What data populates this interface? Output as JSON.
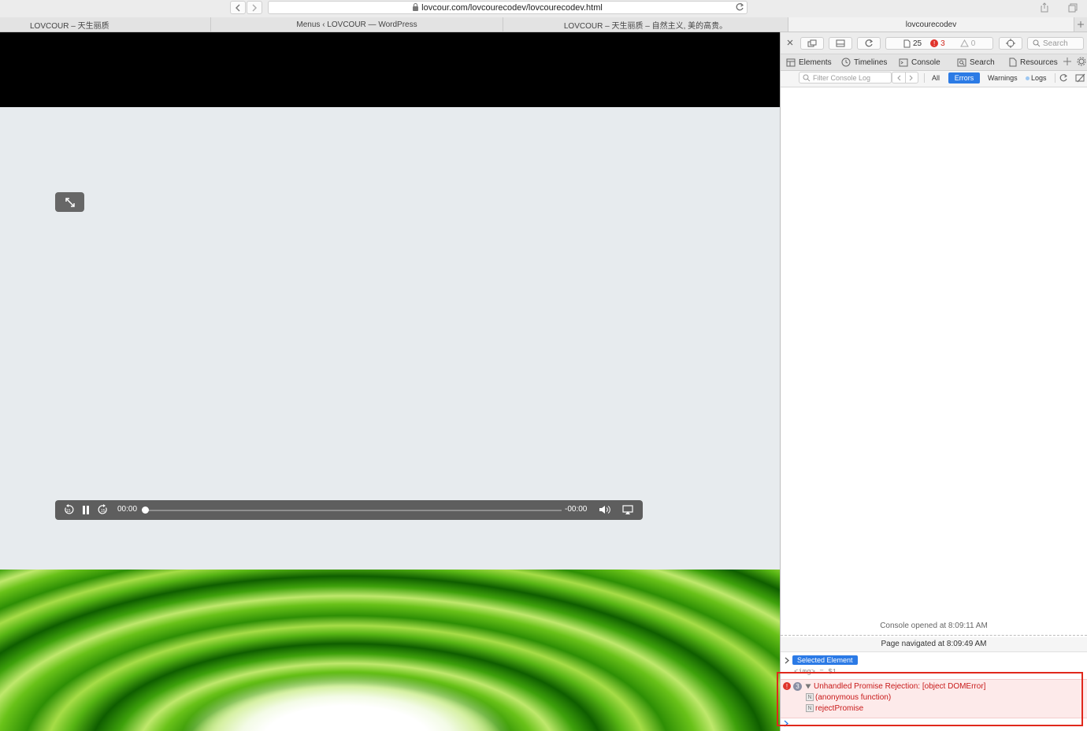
{
  "browser": {
    "url": "lovcour.com/lovcourecodev/lovcourecodev.html",
    "tabs": [
      {
        "title": "LOVCOUR – 天生丽质"
      },
      {
        "title": "Menus ‹ LOVCOUR — WordPress"
      },
      {
        "title": "LOVCOUR – 天生丽质 – 自然主义, 美的高贵。"
      },
      {
        "title": "lovcourecodev"
      }
    ]
  },
  "video": {
    "current_time": "00:00",
    "remaining_time": "-00:00",
    "progress": 0
  },
  "devtools": {
    "resource_count": "25",
    "error_count": "3",
    "warning_count": "0",
    "search_placeholder": "Search",
    "tabs": [
      {
        "label": "Elements"
      },
      {
        "label": "Timelines"
      },
      {
        "label": "Console"
      },
      {
        "label": "Search"
      },
      {
        "label": "Resources"
      }
    ],
    "filter": {
      "placeholder": "Filter Console Log",
      "all": "All",
      "errors": "Errors",
      "warnings": "Warnings",
      "logs": "Logs"
    },
    "console": {
      "opened_msg": "Console opened at 8:09:11 AM",
      "navigated_msg": "Page navigated at 8:09:49 AM",
      "selected_badge": "Selected Element",
      "img_row": "<img> = $1",
      "error_repeat": "3",
      "error_message": "Unhandled Promise Rejection: [object DOMError]",
      "stack": [
        "(anonymous function)",
        "rejectPromise"
      ]
    }
  }
}
